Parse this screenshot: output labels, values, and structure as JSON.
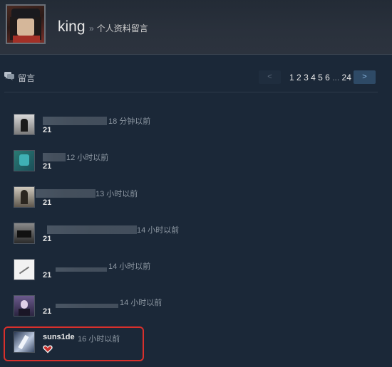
{
  "header": {
    "profile_name": "king",
    "breadcrumb_sep": "»",
    "breadcrumb_label": "个人资料留言"
  },
  "section": {
    "title": "留言",
    "icon": "comment-icon"
  },
  "pagination": {
    "prev_label": "<",
    "next_label": ">",
    "pages": [
      "1",
      "2",
      "3",
      "4",
      "5",
      "6"
    ],
    "current_page": "1",
    "ellipsis": "...",
    "last_page": "24"
  },
  "comments": [
    {
      "author_redacted": true,
      "time": "18 分钟以前",
      "text": "21"
    },
    {
      "author_redacted": true,
      "time": "12 小时以前",
      "text": "21"
    },
    {
      "author_redacted": true,
      "time": "13 小时以前",
      "text": "21"
    },
    {
      "author_redacted": true,
      "time": "14 小时以前",
      "text": "21"
    },
    {
      "author_redacted": true,
      "time": "14 小时以前",
      "text": "21"
    },
    {
      "author_redacted": true,
      "time": "14 小时以前",
      "text": "21"
    },
    {
      "author": "suns1de",
      "time": "16 小时以前",
      "text_icon": "heart-icon"
    }
  ],
  "colors": {
    "background": "#1b2838",
    "header_bg": "#2a313c",
    "highlight": "#d8302c",
    "heart": "#c8302c"
  }
}
